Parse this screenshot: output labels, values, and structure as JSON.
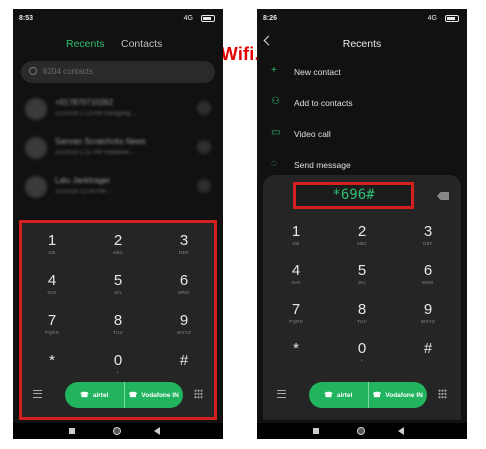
{
  "watermark": "FactWifi.com",
  "left": {
    "status": {
      "time": "8:53",
      "signal": "4G",
      "battery": ""
    },
    "tabs": {
      "recents": "Recents",
      "contacts": "Contacts"
    },
    "search": {
      "placeholder": "6204 contacts"
    },
    "recents": [
      {
        "name": "+917870710262",
        "detail": "1/2/2019 1:13 PM Dumgang ..."
      },
      {
        "name": "Sanvan Scratchcks News",
        "detail": "1/2/2019 1:11 PM Vodafone ..."
      },
      {
        "name": "Lalu Janktrager",
        "detail": "1/2/2019 12:50 PM ..."
      }
    ],
    "keys": [
      {
        "digit": "1",
        "letters": "GB"
      },
      {
        "digit": "2",
        "letters": "ABC"
      },
      {
        "digit": "3",
        "letters": "DEF"
      },
      {
        "digit": "4",
        "letters": "GHI"
      },
      {
        "digit": "5",
        "letters": "JKL"
      },
      {
        "digit": "6",
        "letters": "MNO"
      },
      {
        "digit": "7",
        "letters": "PQRS"
      },
      {
        "digit": "8",
        "letters": "TUV"
      },
      {
        "digit": "9",
        "letters": "WXYZ"
      },
      {
        "digit": "*",
        "letters": ""
      },
      {
        "digit": "0",
        "letters": "+"
      },
      {
        "digit": "#",
        "letters": ""
      }
    ],
    "sim1": "airtel",
    "sim2": "Vodafone IN"
  },
  "right": {
    "status": {
      "time": "8:26",
      "signal": "4G",
      "battery": ""
    },
    "title": "Recents",
    "menu": [
      {
        "icon": "plus-icon",
        "glyph": "+",
        "label": "New contact"
      },
      {
        "icon": "person-icon",
        "glyph": "⚇",
        "label": "Add to contacts"
      },
      {
        "icon": "video-icon",
        "glyph": "▭",
        "label": "Video call"
      },
      {
        "icon": "message-icon",
        "glyph": "◌",
        "label": "Send message"
      }
    ],
    "dialed_number": "*696#",
    "keys": [
      {
        "digit": "1",
        "letters": "GB"
      },
      {
        "digit": "2",
        "letters": "ABC"
      },
      {
        "digit": "3",
        "letters": "DEF"
      },
      {
        "digit": "4",
        "letters": "GHI"
      },
      {
        "digit": "5",
        "letters": "JKL"
      },
      {
        "digit": "6",
        "letters": "MNO"
      },
      {
        "digit": "7",
        "letters": "PQRS"
      },
      {
        "digit": "8",
        "letters": "TUV"
      },
      {
        "digit": "9",
        "letters": "WXYZ"
      },
      {
        "digit": "*",
        "letters": ""
      },
      {
        "digit": "0",
        "letters": "+"
      },
      {
        "digit": "#",
        "letters": ""
      }
    ],
    "sim1": "airtel",
    "sim2": "Vodafone IN"
  },
  "colors": {
    "accent": "#2fbf71",
    "call_button": "#22b35e",
    "highlight": "#d61f1f",
    "watermark": "#e50000"
  }
}
